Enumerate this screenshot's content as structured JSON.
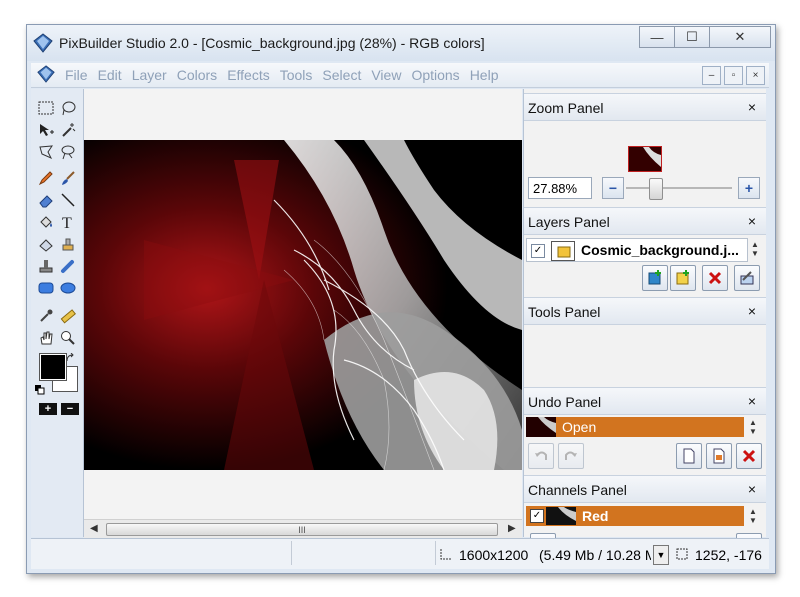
{
  "window": {
    "title": "PixBuilder Studio 2.0 - [Cosmic_background.jpg (28%) - RGB colors]",
    "minimize_glyph": "—",
    "maximize_glyph": "☐",
    "close_glyph": "✕"
  },
  "menubar": {
    "items": [
      "File",
      "Edit",
      "Layer",
      "Colors",
      "Effects",
      "Tools",
      "Select",
      "View",
      "Options",
      "Help"
    ],
    "mdi": {
      "minimize": "–",
      "restore": "▫",
      "close": "×"
    }
  },
  "toolbox": {
    "tools": [
      "rect-select",
      "lasso",
      "move",
      "magic-wand",
      "polygon-lasso",
      "magnetic-lasso",
      "pencil",
      "brush",
      "eraser",
      "line",
      "fill-bucket",
      "text",
      "gradient",
      "clone-stamp",
      "stamp",
      "smudge",
      "rectangle",
      "ellipse",
      "eyedropper",
      "ruler",
      "hand",
      "zoom"
    ],
    "plus": "+",
    "minus": "−",
    "foreground_color": "#000000",
    "background_color": "#ffffff"
  },
  "canvas": {
    "scroll_grip": "III"
  },
  "panels": {
    "zoom": {
      "title": "Zoom Panel",
      "close": "×",
      "value": "27.88%",
      "minus": "−",
      "plus": "+",
      "slider_level": 0.28
    },
    "layers": {
      "title": "Layers Panel",
      "close": "×",
      "layer_name": "Cosmic_background.j...",
      "checked": "✓"
    },
    "tools": {
      "title": "Tools Panel",
      "close": "×"
    },
    "undo": {
      "title": "Undo Panel",
      "close": "×",
      "entry": "Open"
    },
    "channels": {
      "title": "Channels Panel",
      "close": "×",
      "entry": "Red",
      "checked": "✓"
    }
  },
  "statusbar": {
    "size": "1600x1200",
    "memory": "(5.49 Mb / 10.28 M",
    "coords": "1252, -176"
  },
  "colors": {
    "accent_orange": "#d2741f",
    "panel_header": "#e2e8f0",
    "frame": "#dfe8f3"
  }
}
